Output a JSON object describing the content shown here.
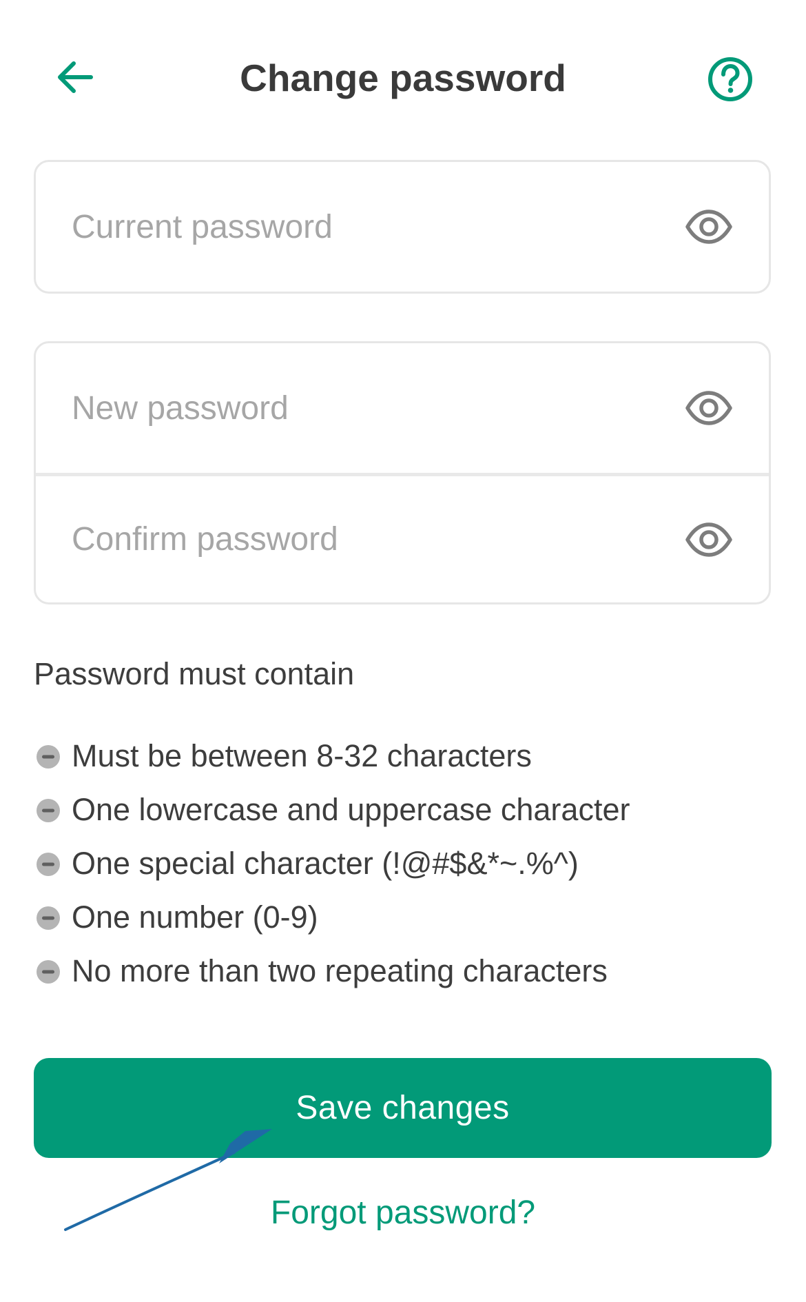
{
  "header": {
    "title": "Change password",
    "back_icon": "arrow-left-icon",
    "help_icon": "question-circle-icon"
  },
  "fields": {
    "current_password": {
      "placeholder": "Current password",
      "value": ""
    },
    "new_password": {
      "placeholder": "New password",
      "value": ""
    },
    "confirm_password": {
      "placeholder": "Confirm password",
      "value": ""
    },
    "toggle_icon": "eye-icon"
  },
  "rules": {
    "title": "Password must contain",
    "status_icon": "minus-circle-icon",
    "items": [
      "Must be between 8-32 characters",
      "One lowercase and uppercase character",
      "One special character (!@#$&*~.%^)",
      "One number (0-9)",
      "No more than two repeating characters"
    ]
  },
  "actions": {
    "save_label": "Save changes",
    "forgot_label": "Forgot password?"
  },
  "colors": {
    "accent": "#029a78",
    "title_text": "#3a3a3a",
    "placeholder": "#a6a6a6",
    "field_border": "#e6e6e6",
    "rule_icon": "#b4b4b4",
    "annotation_arrow": "#1f6aa6"
  }
}
